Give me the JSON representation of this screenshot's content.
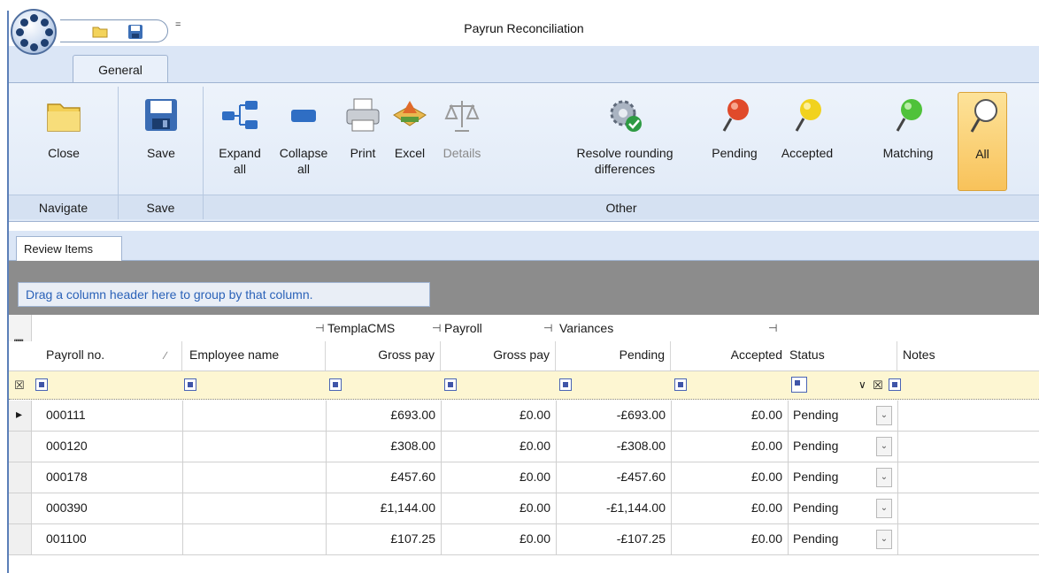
{
  "window": {
    "title": "Payrun Reconciliation"
  },
  "qat": {
    "icons": [
      "folder-icon",
      "save-icon"
    ],
    "caret": "="
  },
  "ribbon": {
    "tab": "General",
    "groups": {
      "navigate": {
        "label": "Navigate",
        "close": "Close"
      },
      "save": {
        "label": "Save",
        "save": "Save"
      },
      "other": {
        "label": "Other",
        "expand_all_1": "Expand",
        "expand_all_2": "all",
        "collapse_all_1": "Collapse",
        "collapse_all_2": "all",
        "print": "Print",
        "excel": "Excel",
        "details": "Details",
        "resolve_1": "Resolve rounding",
        "resolve_2": "differences",
        "pending": "Pending",
        "accepted": "Accepted",
        "matching": "Matching",
        "all": "All"
      }
    }
  },
  "doc_tab": "Review Items",
  "grid": {
    "group_by_hint": "Drag a column header here to group by that column.",
    "bands": {
      "templacms": "TemplaCMS",
      "payroll": "Payroll",
      "variances": "Variances"
    },
    "columns": {
      "payroll_no": "Payroll no.",
      "employee_name": "Employee name",
      "templacms_gross": "Gross pay",
      "payroll_gross": "Gross pay",
      "pending": "Pending",
      "accepted": "Accepted",
      "status": "Status",
      "notes": "Notes"
    },
    "rows": [
      {
        "payroll_no": "000111",
        "employee_name": "",
        "templacms_gross": "£693.00",
        "payroll_gross": "£0.00",
        "pending": "-£693.00",
        "accepted": "£0.00",
        "status": "Pending",
        "notes": ""
      },
      {
        "payroll_no": "000120",
        "employee_name": "",
        "templacms_gross": "£308.00",
        "payroll_gross": "£0.00",
        "pending": "-£308.00",
        "accepted": "£0.00",
        "status": "Pending",
        "notes": ""
      },
      {
        "payroll_no": "000178",
        "employee_name": "",
        "templacms_gross": "£457.60",
        "payroll_gross": "£0.00",
        "pending": "-£457.60",
        "accepted": "£0.00",
        "status": "Pending",
        "notes": ""
      },
      {
        "payroll_no": "000390",
        "employee_name": "",
        "templacms_gross": "£1,144.00",
        "payroll_gross": "£0.00",
        "pending": "-£1,144.00",
        "accepted": "£0.00",
        "status": "Pending",
        "notes": ""
      },
      {
        "payroll_no": "001100",
        "employee_name": "",
        "templacms_gross": "£107.25",
        "payroll_gross": "£0.00",
        "pending": "-£107.25",
        "accepted": "£0.00",
        "status": "Pending",
        "notes": ""
      }
    ]
  }
}
